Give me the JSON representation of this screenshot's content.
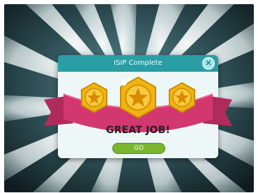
{
  "dialog": {
    "title": "ISIP Complete",
    "message": "GREAT JOB!",
    "go_label": "GO",
    "close_icon": "close-icon"
  },
  "colors": {
    "header": "#2a9ea5",
    "ribbon": "#d2386f",
    "badge_gold": "#f1b315",
    "go_button": "#7ab62e"
  }
}
